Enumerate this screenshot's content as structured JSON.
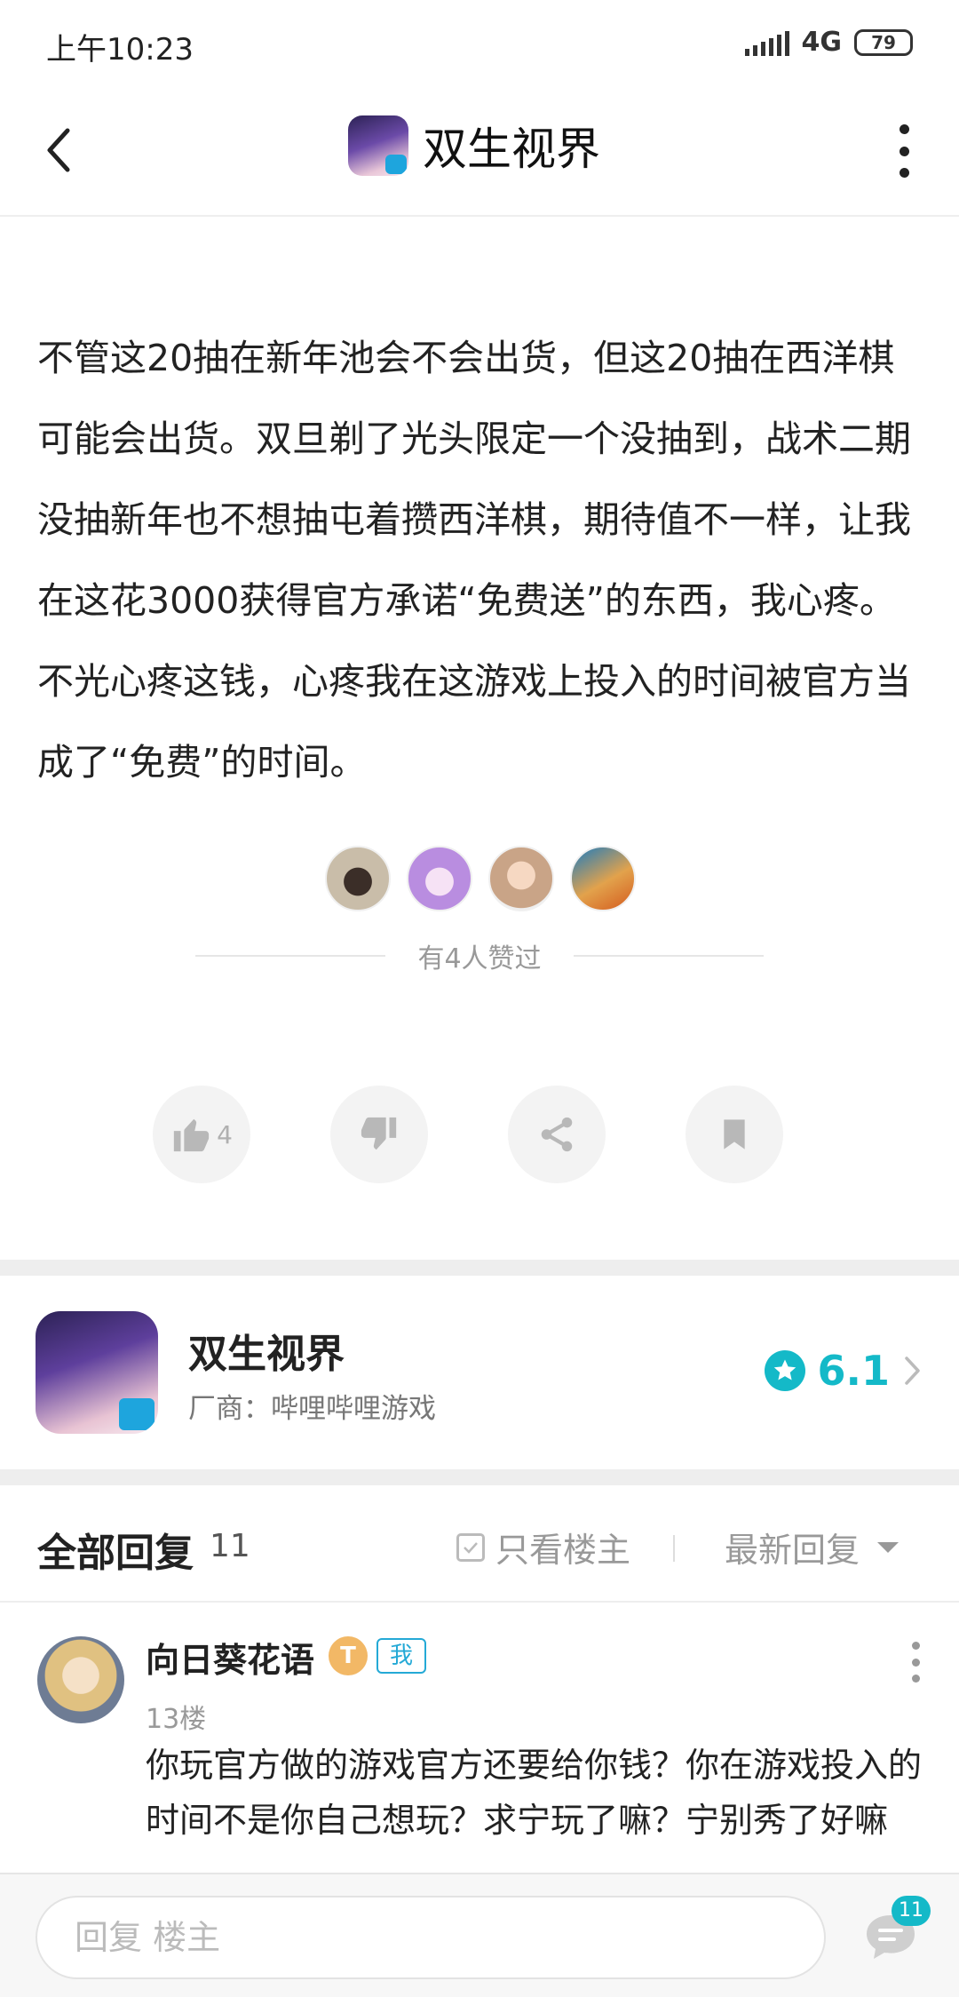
{
  "status_bar": {
    "time": "上午10:23",
    "network": "4G",
    "battery": "79"
  },
  "nav": {
    "title": "双生视界"
  },
  "post": {
    "body": "不管这20抽在新年池会不会出货，但这20抽在西洋棋可能会出货。双旦剃了光头限定一个没抽到，战术二期没抽新年也不想抽屯着攒西洋棋，期待值不一样，让我在这花3000获得官方承诺“免费送”的东西，我心疼。不光心疼这钱，心疼我在这游戏上投入的时间被官方当成了“免费”的时间。",
    "liked_text": "有4人赞过",
    "like_count": "4"
  },
  "game_card": {
    "name": "双生视界",
    "vendor": "厂商：哔哩哔哩游戏",
    "score": "6.1"
  },
  "replies": {
    "title": "全部回复",
    "count": "11",
    "only_op_label": "只看楼主",
    "sort_label": "最新回复"
  },
  "comment": {
    "username": "向日葵花语",
    "level_badge": "T",
    "me_badge": "我",
    "floor": "13楼",
    "text": "你玩官方做的游戏官方还要给你钱？你在游戏投入的时间不是你自己想玩？求宁玩了嘛？宁别秀了好嘛"
  },
  "reply_bar": {
    "placeholder": "回复  楼主",
    "badge_count": "11"
  },
  "colors": {
    "accent": "#14b9c8",
    "badge_blue": "#24a9d6",
    "divider": "#eeeeee"
  }
}
